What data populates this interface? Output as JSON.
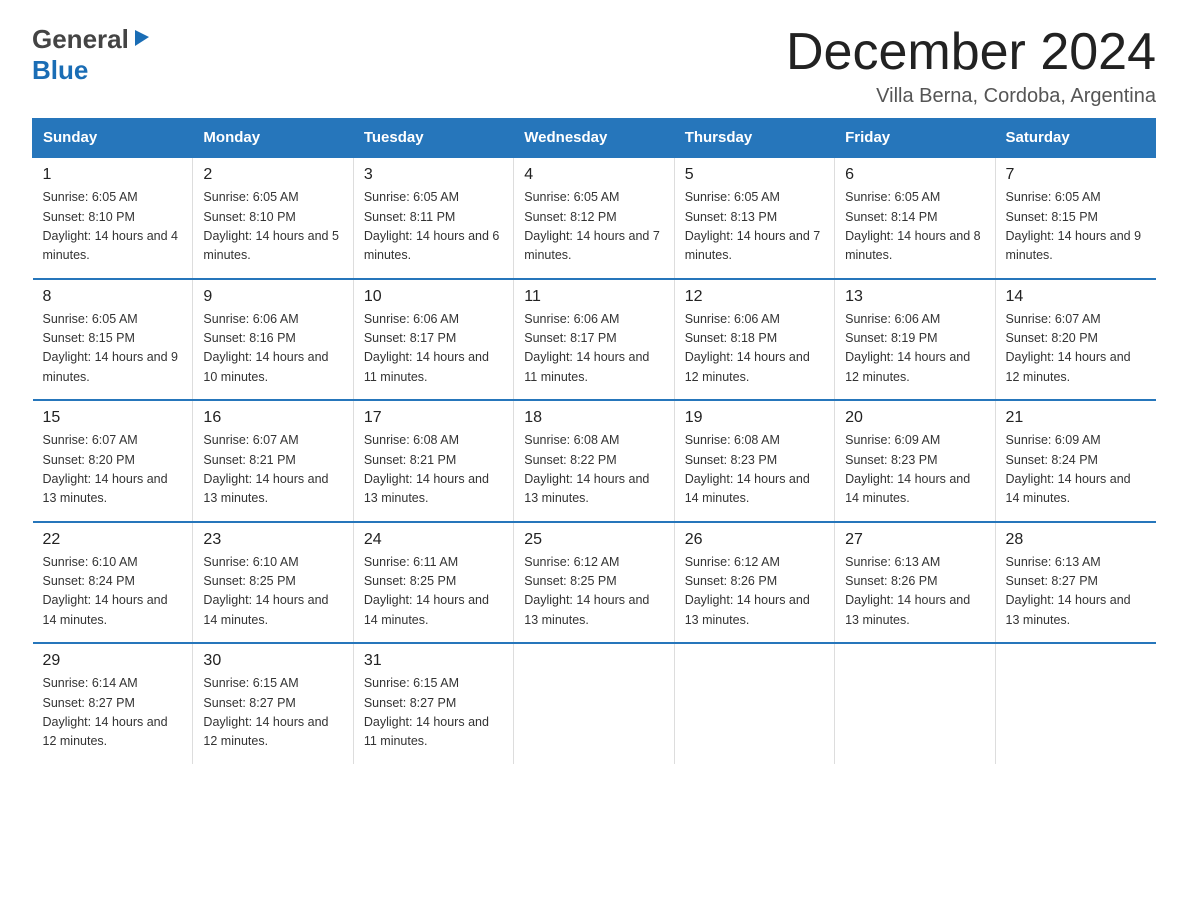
{
  "header": {
    "logo_general": "General",
    "logo_blue": "Blue",
    "month_title": "December 2024",
    "subtitle": "Villa Berna, Cordoba, Argentina"
  },
  "days_of_week": [
    "Sunday",
    "Monday",
    "Tuesday",
    "Wednesday",
    "Thursday",
    "Friday",
    "Saturday"
  ],
  "weeks": [
    [
      {
        "day": "1",
        "sunrise": "Sunrise: 6:05 AM",
        "sunset": "Sunset: 8:10 PM",
        "daylight": "Daylight: 14 hours and 4 minutes."
      },
      {
        "day": "2",
        "sunrise": "Sunrise: 6:05 AM",
        "sunset": "Sunset: 8:10 PM",
        "daylight": "Daylight: 14 hours and 5 minutes."
      },
      {
        "day": "3",
        "sunrise": "Sunrise: 6:05 AM",
        "sunset": "Sunset: 8:11 PM",
        "daylight": "Daylight: 14 hours and 6 minutes."
      },
      {
        "day": "4",
        "sunrise": "Sunrise: 6:05 AM",
        "sunset": "Sunset: 8:12 PM",
        "daylight": "Daylight: 14 hours and 7 minutes."
      },
      {
        "day": "5",
        "sunrise": "Sunrise: 6:05 AM",
        "sunset": "Sunset: 8:13 PM",
        "daylight": "Daylight: 14 hours and 7 minutes."
      },
      {
        "day": "6",
        "sunrise": "Sunrise: 6:05 AM",
        "sunset": "Sunset: 8:14 PM",
        "daylight": "Daylight: 14 hours and 8 minutes."
      },
      {
        "day": "7",
        "sunrise": "Sunrise: 6:05 AM",
        "sunset": "Sunset: 8:15 PM",
        "daylight": "Daylight: 14 hours and 9 minutes."
      }
    ],
    [
      {
        "day": "8",
        "sunrise": "Sunrise: 6:05 AM",
        "sunset": "Sunset: 8:15 PM",
        "daylight": "Daylight: 14 hours and 9 minutes."
      },
      {
        "day": "9",
        "sunrise": "Sunrise: 6:06 AM",
        "sunset": "Sunset: 8:16 PM",
        "daylight": "Daylight: 14 hours and 10 minutes."
      },
      {
        "day": "10",
        "sunrise": "Sunrise: 6:06 AM",
        "sunset": "Sunset: 8:17 PM",
        "daylight": "Daylight: 14 hours and 11 minutes."
      },
      {
        "day": "11",
        "sunrise": "Sunrise: 6:06 AM",
        "sunset": "Sunset: 8:17 PM",
        "daylight": "Daylight: 14 hours and 11 minutes."
      },
      {
        "day": "12",
        "sunrise": "Sunrise: 6:06 AM",
        "sunset": "Sunset: 8:18 PM",
        "daylight": "Daylight: 14 hours and 12 minutes."
      },
      {
        "day": "13",
        "sunrise": "Sunrise: 6:06 AM",
        "sunset": "Sunset: 8:19 PM",
        "daylight": "Daylight: 14 hours and 12 minutes."
      },
      {
        "day": "14",
        "sunrise": "Sunrise: 6:07 AM",
        "sunset": "Sunset: 8:20 PM",
        "daylight": "Daylight: 14 hours and 12 minutes."
      }
    ],
    [
      {
        "day": "15",
        "sunrise": "Sunrise: 6:07 AM",
        "sunset": "Sunset: 8:20 PM",
        "daylight": "Daylight: 14 hours and 13 minutes."
      },
      {
        "day": "16",
        "sunrise": "Sunrise: 6:07 AM",
        "sunset": "Sunset: 8:21 PM",
        "daylight": "Daylight: 14 hours and 13 minutes."
      },
      {
        "day": "17",
        "sunrise": "Sunrise: 6:08 AM",
        "sunset": "Sunset: 8:21 PM",
        "daylight": "Daylight: 14 hours and 13 minutes."
      },
      {
        "day": "18",
        "sunrise": "Sunrise: 6:08 AM",
        "sunset": "Sunset: 8:22 PM",
        "daylight": "Daylight: 14 hours and 13 minutes."
      },
      {
        "day": "19",
        "sunrise": "Sunrise: 6:08 AM",
        "sunset": "Sunset: 8:23 PM",
        "daylight": "Daylight: 14 hours and 14 minutes."
      },
      {
        "day": "20",
        "sunrise": "Sunrise: 6:09 AM",
        "sunset": "Sunset: 8:23 PM",
        "daylight": "Daylight: 14 hours and 14 minutes."
      },
      {
        "day": "21",
        "sunrise": "Sunrise: 6:09 AM",
        "sunset": "Sunset: 8:24 PM",
        "daylight": "Daylight: 14 hours and 14 minutes."
      }
    ],
    [
      {
        "day": "22",
        "sunrise": "Sunrise: 6:10 AM",
        "sunset": "Sunset: 8:24 PM",
        "daylight": "Daylight: 14 hours and 14 minutes."
      },
      {
        "day": "23",
        "sunrise": "Sunrise: 6:10 AM",
        "sunset": "Sunset: 8:25 PM",
        "daylight": "Daylight: 14 hours and 14 minutes."
      },
      {
        "day": "24",
        "sunrise": "Sunrise: 6:11 AM",
        "sunset": "Sunset: 8:25 PM",
        "daylight": "Daylight: 14 hours and 14 minutes."
      },
      {
        "day": "25",
        "sunrise": "Sunrise: 6:12 AM",
        "sunset": "Sunset: 8:25 PM",
        "daylight": "Daylight: 14 hours and 13 minutes."
      },
      {
        "day": "26",
        "sunrise": "Sunrise: 6:12 AM",
        "sunset": "Sunset: 8:26 PM",
        "daylight": "Daylight: 14 hours and 13 minutes."
      },
      {
        "day": "27",
        "sunrise": "Sunrise: 6:13 AM",
        "sunset": "Sunset: 8:26 PM",
        "daylight": "Daylight: 14 hours and 13 minutes."
      },
      {
        "day": "28",
        "sunrise": "Sunrise: 6:13 AM",
        "sunset": "Sunset: 8:27 PM",
        "daylight": "Daylight: 14 hours and 13 minutes."
      }
    ],
    [
      {
        "day": "29",
        "sunrise": "Sunrise: 6:14 AM",
        "sunset": "Sunset: 8:27 PM",
        "daylight": "Daylight: 14 hours and 12 minutes."
      },
      {
        "day": "30",
        "sunrise": "Sunrise: 6:15 AM",
        "sunset": "Sunset: 8:27 PM",
        "daylight": "Daylight: 14 hours and 12 minutes."
      },
      {
        "day": "31",
        "sunrise": "Sunrise: 6:15 AM",
        "sunset": "Sunset: 8:27 PM",
        "daylight": "Daylight: 14 hours and 11 minutes."
      },
      null,
      null,
      null,
      null
    ]
  ]
}
